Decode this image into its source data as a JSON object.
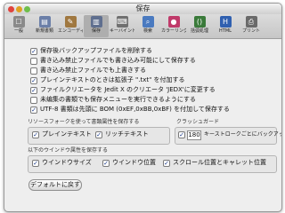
{
  "window": {
    "title": "保存"
  },
  "toolbar": {
    "items": [
      {
        "label": "一般",
        "icon": "☐",
        "color": "#8a8a8a"
      },
      {
        "label": "新規書類",
        "icon": "▤",
        "color": "#6b7fa8"
      },
      {
        "label": "エンコーディング",
        "icon": "✎",
        "color": "#a07840"
      },
      {
        "label": "保存",
        "icon": "▥",
        "color": "#5f6f8f"
      },
      {
        "label": "キーバインド",
        "icon": "⌨",
        "color": "#707070"
      },
      {
        "label": "検索",
        "icon": "⌕",
        "color": "#4a7ac0"
      },
      {
        "label": "カラーリング",
        "icon": "●",
        "color": "#c03a6a"
      },
      {
        "label": "括弧処理",
        "icon": "()",
        "color": "#3a7a3a"
      },
      {
        "label": "HTML",
        "icon": "H",
        "color": "#3060b0"
      },
      {
        "label": "プリント",
        "icon": "⎙",
        "color": "#6a6a6a"
      }
    ]
  },
  "options": [
    {
      "label": "保存後バックアップファイルを削除する",
      "checked": true
    },
    {
      "label": "書き込み禁止ファイルでも書き込み可能にして保存する",
      "checked": false
    },
    {
      "label": "書き込み禁止ファイルでも上書きする",
      "checked": false
    },
    {
      "label": "プレインテキストのときは拡張子 \".txt\" を付加する",
      "checked": true
    },
    {
      "label": "ファイルクリエータを Jedit X のクリエータ 'JEDX'に変更する",
      "checked": true
    },
    {
      "label": "未编集の書類でも保存メニューを実行できるようにする",
      "checked": false
    },
    {
      "label": "UTF-8 書類は先頭に BOM (0xEF,0xBB,0xBF) を付加して保存する",
      "checked": true
    }
  ],
  "resource_fork": {
    "label": "リソースフォークを使って書類属性を保存する",
    "items": [
      {
        "label": "プレインテキスト",
        "checked": true
      },
      {
        "label": "リッチテキスト",
        "checked": true
      }
    ]
  },
  "crash_guard": {
    "label": "クラッシュガード",
    "checked": true,
    "value": "180",
    "suffix": "キーストロークごとにバックアップ"
  },
  "window_attrs": {
    "label": "以下のウインドウ属性を保存する",
    "items": [
      {
        "label": "ウインドウサイズ",
        "checked": true
      },
      {
        "label": "ウインドウ位置",
        "checked": true
      },
      {
        "label": "スクロール位置とキャレット位置",
        "checked": true
      }
    ]
  },
  "defaults_button": "デフォルトに戻す",
  "check_mark": "✓"
}
